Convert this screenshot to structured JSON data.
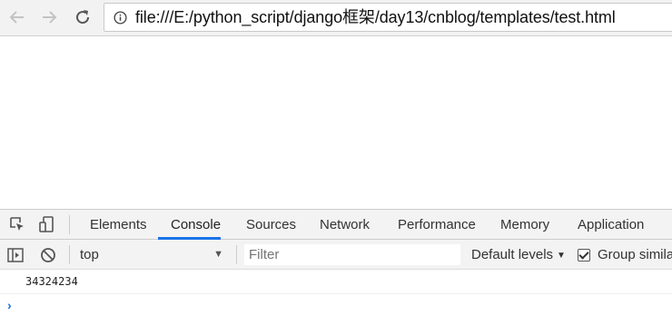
{
  "browser": {
    "url": "file:///E:/python_script/django框架/day13/cnblog/templates/test.html"
  },
  "devtools": {
    "tabs": [
      {
        "label": "Elements"
      },
      {
        "label": "Console"
      },
      {
        "label": "Sources"
      },
      {
        "label": "Network"
      },
      {
        "label": "Performance"
      },
      {
        "label": "Memory"
      },
      {
        "label": "Application"
      }
    ],
    "active_tab": "Console",
    "console_bar": {
      "context": "top",
      "filter_placeholder": "Filter",
      "levels": "Default levels",
      "group_similar_label": "Group simila",
      "group_similar_checked": true
    },
    "log": [
      {
        "text": "34324234"
      }
    ],
    "prompt": "›"
  },
  "colors": {
    "accent": "#1a73e8",
    "toolbar_bg": "#f2f2f2",
    "devtools_bg": "#f3f3f3"
  }
}
